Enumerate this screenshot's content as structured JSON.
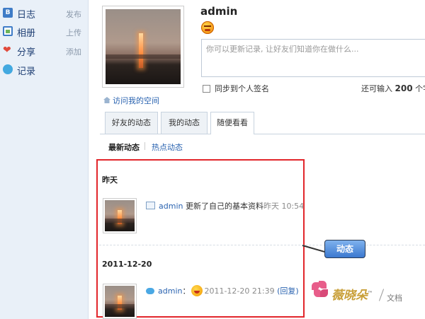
{
  "sidebar": {
    "items": [
      {
        "label": "日志",
        "action": "发布"
      },
      {
        "label": "相册",
        "action": "上传"
      },
      {
        "label": "分享",
        "action": "添加"
      },
      {
        "label": "记录",
        "action": ""
      }
    ]
  },
  "profile": {
    "username": "admin",
    "visit_space": "访问我的空间",
    "status_placeholder": "你可以更新记录, 让好友们知道你在做什么...",
    "sync_label": "同步到个人签名",
    "remain_prefix": "还可输入",
    "remain_count": "200",
    "remain_suffix": "个字"
  },
  "tabs": [
    {
      "label": "好友的动态",
      "active": false
    },
    {
      "label": "我的动态",
      "active": false
    },
    {
      "label": "随便看看",
      "active": true
    }
  ],
  "subtabs": [
    {
      "label": "最新动态",
      "active": true
    },
    {
      "label": "热点动态",
      "active": false
    }
  ],
  "feed": {
    "groups": [
      {
        "date": "昨天",
        "entry": {
          "user": "admin",
          "text": " 更新了自己的基本资料",
          "time": "昨天 10:54"
        }
      },
      {
        "date": "2011-12-20",
        "entry": {
          "user": "admin",
          "text": "：",
          "time": "2011-12-20 21:39",
          "reply": "(回复)"
        }
      }
    ]
  },
  "callout": {
    "label": "动态"
  },
  "watermark": {
    "brand": "薇晓朵",
    "tm": "™",
    "doc": "文档"
  },
  "colors": {
    "accent_link": "#2a63b0",
    "highlight_frame": "#e2262b",
    "sidebar_bg": "#e9f0f8"
  }
}
